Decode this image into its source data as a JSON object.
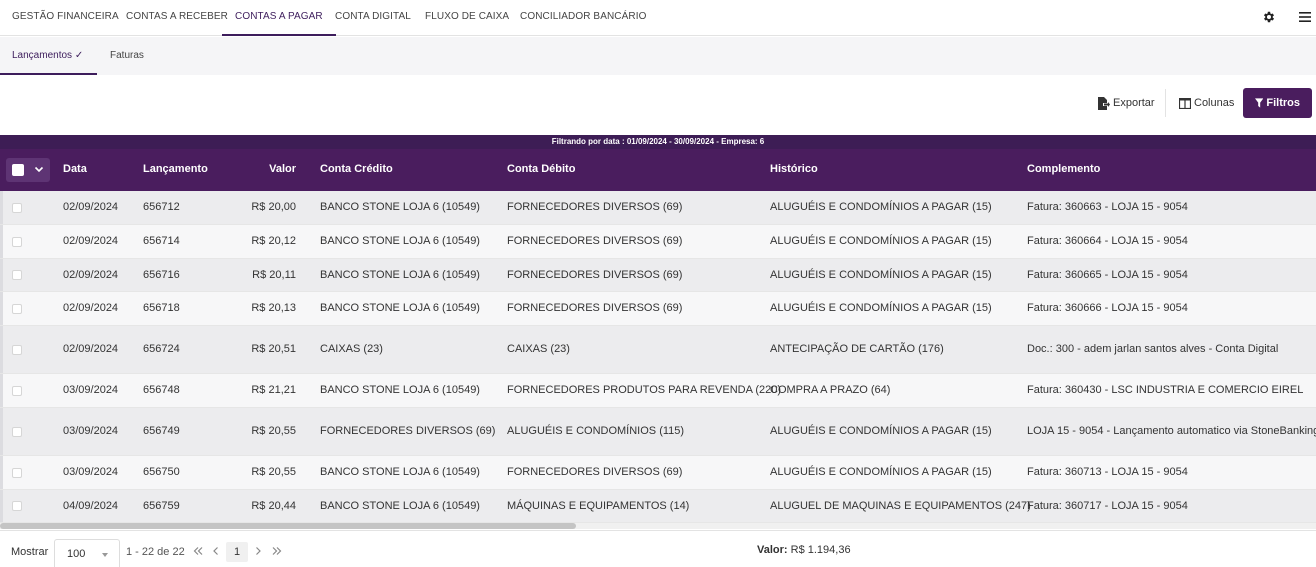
{
  "topnav": {
    "tabs": [
      {
        "label": "GESTÃO FINANCEIRA"
      },
      {
        "label": "CONTAS A RECEBER"
      },
      {
        "label": "CONTAS A PAGAR",
        "active": true
      },
      {
        "label": "CONTA DIGITAL"
      },
      {
        "label": "FLUXO DE CAIXA"
      },
      {
        "label": "CONCILIADOR BANCÁRIO"
      }
    ],
    "icons": [
      "gear-icon",
      "hamburger-menu-icon"
    ]
  },
  "subnav": {
    "tabs": [
      {
        "label": "Lançamentos ✓",
        "active": true
      },
      {
        "label": "Faturas"
      }
    ]
  },
  "toolbar": {
    "export_label": "Exportar",
    "columns_label": "Colunas",
    "filters_label": "Filtros"
  },
  "filter_banner": "Filtrando por data : 01/09/2024 - 30/09/2024 - Empresa: 6",
  "table": {
    "headers": {
      "data": "Data",
      "lancamento": "Lançamento",
      "valor": "Valor",
      "conta_credito": "Conta Crédito",
      "conta_debito": "Conta Débito",
      "historico": "Histórico",
      "complemento": "Complemento"
    },
    "rows": [
      {
        "data": "02/09/2024",
        "lancamento": "656712",
        "valor": "R$ 20,00",
        "conta_credito": "BANCO STONE LOJA 6 (10549)",
        "conta_debito": "FORNECEDORES DIVERSOS (69)",
        "historico": "ALUGUÉIS E CONDOMÍNIOS A PAGAR (15)",
        "complemento": "Fatura: 360663 - LOJA 15 - 9054"
      },
      {
        "data": "02/09/2024",
        "lancamento": "656714",
        "valor": "R$ 20,12",
        "conta_credito": "BANCO STONE LOJA 6 (10549)",
        "conta_debito": "FORNECEDORES DIVERSOS (69)",
        "historico": "ALUGUÉIS E CONDOMÍNIOS A PAGAR (15)",
        "complemento": "Fatura: 360664 - LOJA 15 - 9054"
      },
      {
        "data": "02/09/2024",
        "lancamento": "656716",
        "valor": "R$ 20,11",
        "conta_credito": "BANCO STONE LOJA 6 (10549)",
        "conta_debito": "FORNECEDORES DIVERSOS (69)",
        "historico": "ALUGUÉIS E CONDOMÍNIOS A PAGAR (15)",
        "complemento": "Fatura: 360665 - LOJA 15 - 9054"
      },
      {
        "data": "02/09/2024",
        "lancamento": "656718",
        "valor": "R$ 20,13",
        "conta_credito": "BANCO STONE LOJA 6 (10549)",
        "conta_debito": "FORNECEDORES DIVERSOS (69)",
        "historico": "ALUGUÉIS E CONDOMÍNIOS A PAGAR (15)",
        "complemento": "Fatura: 360666 - LOJA 15 - 9054"
      },
      {
        "data": "02/09/2024",
        "lancamento": "656724",
        "valor": "R$ 20,51",
        "conta_credito": "CAIXAS (23)",
        "conta_debito": "CAIXAS (23)",
        "historico": "ANTECIPAÇÃO DE CARTÃO (176)",
        "complemento": "Doc.: 300 - adem jarlan santos alves - Conta Digital"
      },
      {
        "data": "03/09/2024",
        "lancamento": "656748",
        "valor": "R$ 21,21",
        "conta_credito": "BANCO STONE LOJA 6 (10549)",
        "conta_debito": "FORNECEDORES PRODUTOS PARA REVENDA (220)",
        "historico": "COMPRA A PRAZO (64)",
        "complemento": "Fatura: 360430 - LSC INDUSTRIA E COMERCIO EIREL"
      },
      {
        "data": "03/09/2024",
        "lancamento": "656749",
        "valor": "R$ 20,55",
        "conta_credito": "FORNECEDORES DIVERSOS (69)",
        "conta_debito": "ALUGUÉIS E CONDOMÍNIOS (115)",
        "historico": "ALUGUÉIS E CONDOMÍNIOS A PAGAR (15)",
        "complemento": "LOJA 15 - 9054 - Lançamento automatico via StoneBanking"
      },
      {
        "data": "03/09/2024",
        "lancamento": "656750",
        "valor": "R$ 20,55",
        "conta_credito": "BANCO STONE LOJA 6 (10549)",
        "conta_debito": "FORNECEDORES DIVERSOS (69)",
        "historico": "ALUGUÉIS E CONDOMÍNIOS A PAGAR (15)",
        "complemento": "Fatura: 360713 - LOJA 15 - 9054"
      },
      {
        "data": "04/09/2024",
        "lancamento": "656759",
        "valor": "R$ 20,44",
        "conta_credito": "BANCO STONE LOJA 6 (10549)",
        "conta_debito": "MÁQUINAS E EQUIPAMENTOS (14)",
        "historico": "ALUGUEL DE MAQUINAS E EQUIPAMENTOS (247)",
        "complemento": "Fatura: 360717 - LOJA 15 - 9054"
      }
    ]
  },
  "footer": {
    "show_label": "Mostrar",
    "page_size": "100",
    "range": "1 - 22 de 22",
    "current_page": "1",
    "total_label": "Valor:",
    "total_value": "R$ 1.194,36"
  },
  "colors": {
    "brand_purple": "#4a1d5e",
    "banner_purple": "#3d1d55"
  }
}
